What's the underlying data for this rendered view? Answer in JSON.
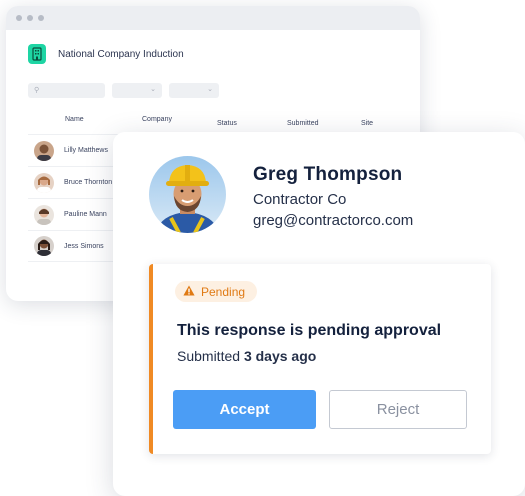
{
  "background_window": {
    "title": "National Company Induction",
    "columns": [
      "Name",
      "Company",
      "Status",
      "Submitted",
      "Site"
    ],
    "rows": [
      {
        "name": "Lilly Matthews"
      },
      {
        "name": "Bruce Thornton"
      },
      {
        "name": "Pauline Mann"
      },
      {
        "name": "Jess Simons"
      }
    ]
  },
  "profile": {
    "name": "Greg Thompson",
    "company": "Contractor Co",
    "email": "greg@contractorco.com"
  },
  "approval": {
    "badge": "Pending",
    "title": "This response is pending approval",
    "submitted_prefix": "Submitted",
    "submitted_value": "3 days ago",
    "accept_label": "Accept",
    "reject_label": "Reject"
  },
  "colors": {
    "accent": "#4b9df5",
    "pending": "#f08a24",
    "brand": "#1ed5a4"
  }
}
